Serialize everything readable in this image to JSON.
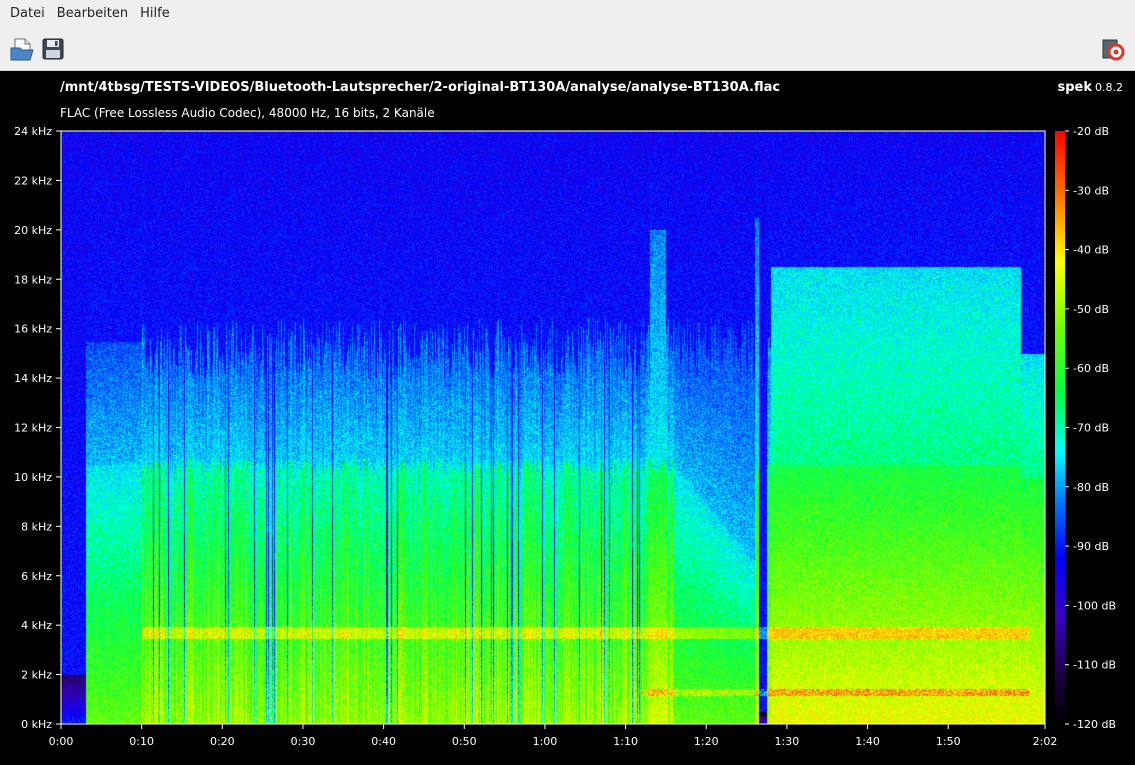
{
  "menu": {
    "items": [
      "Datei",
      "Bearbeiten",
      "Hilfe"
    ]
  },
  "toolbar": {
    "open_icon": "open-file-icon",
    "save_icon": "save-icon",
    "about_icon": "about-icon"
  },
  "header": {
    "file_path": "/mnt/4tbsg/TESTS-VIDEOS/Bluetooth-Lautsprecher/2-original-BT130A/analyse/analyse-BT130A.flac",
    "file_info": "FLAC (Free Lossless Audio Codec), 48000 Hz, 16 bits, 2 Kanäle",
    "app_name": "spek",
    "app_version": "0.8.2"
  },
  "chart_data": {
    "type": "heatmap",
    "y_ticks": [
      "0 kHz",
      "2 kHz",
      "4 kHz",
      "6 kHz",
      "8 kHz",
      "10 kHz",
      "12 kHz",
      "14 kHz",
      "16 kHz",
      "18 kHz",
      "20 kHz",
      "22 kHz",
      "24 kHz"
    ],
    "x_ticks": [
      "0:00",
      "0:10",
      "0:20",
      "0:30",
      "0:40",
      "0:50",
      "1:00",
      "1:10",
      "1:20",
      "1:30",
      "1:40",
      "1:50",
      "2:02"
    ],
    "colorbar_ticks": [
      "-20 dB",
      "-30 dB",
      "-40 dB",
      "-50 dB",
      "-60 dB",
      "-70 dB",
      "-80 dB",
      "-90 dB",
      "-100 dB",
      "-110 dB",
      "-120 dB"
    ],
    "ylim": [
      0,
      24
    ],
    "xlim_seconds": [
      0,
      122
    ],
    "dB_range": [
      -120,
      -20
    ]
  }
}
